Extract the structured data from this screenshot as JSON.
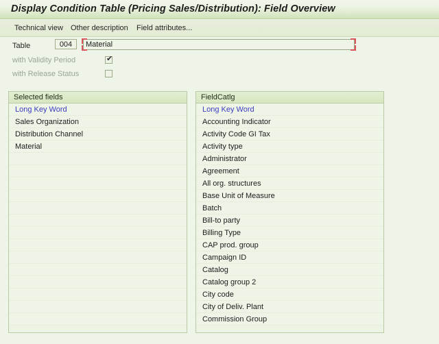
{
  "window": {
    "title": "Display Condition Table (Pricing Sales/Distribution): Field Overview"
  },
  "toolbar": {
    "technical_view": "Technical view",
    "other_description": "Other description",
    "field_attributes": "Field attributes..."
  },
  "form": {
    "table_label": "Table",
    "table_code": "004",
    "table_name_value": "Material",
    "table_name_placeholder": "",
    "validity_label": "with Validity Period",
    "validity_checked": true,
    "validity_tick": "✔",
    "release_label": "with Release Status",
    "release_checked": false,
    "release_tick": ""
  },
  "selected_fields_panel": {
    "header": "Selected fields",
    "column_header": "Long Key Word",
    "items": [
      "Sales Organization",
      "Distribution Channel",
      "Material"
    ],
    "empty_rows": 14
  },
  "field_catalog_panel": {
    "header": "FieldCatlg",
    "column_header": "Long Key Word",
    "items": [
      "Accounting Indicator",
      "Activity Code GI Tax",
      "Activity type",
      "Administrator",
      "Agreement",
      "All org. structures",
      "Base Unit of Measure",
      "Batch",
      "Bill-to party",
      "Billing Type",
      "CAP prod. group",
      "Campaign ID",
      "Catalog",
      "Catalog group 2",
      "City code",
      "City of Deliv. Plant",
      "Commission Group"
    ]
  },
  "colors": {
    "title_bar_gradient_top": "#f2f7ec",
    "title_bar_gradient_bottom": "#cfe3b8",
    "page_background": "#eff4e8",
    "panel_background": "#eef4e6",
    "panel_header": "#d6e7c0",
    "panel_border": "#b9c9a4",
    "column_header_text": "#3b3bc0",
    "focus_bracket": "#d9555b"
  }
}
